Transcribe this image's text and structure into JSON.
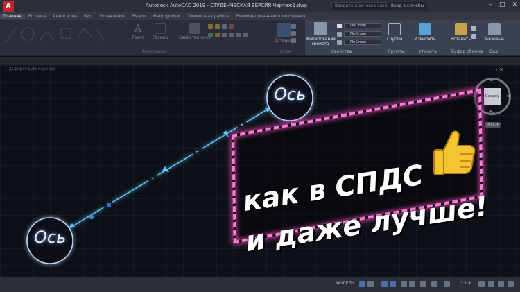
{
  "window": {
    "title": "Autodesk AutoCAD 2019 - СТУДЕНЧЕСКАЯ ВЕРСИЯ    Чертеж1.dwg",
    "app_icon_letter": "A",
    "search_placeholder": "Введите ключевое слово/фразу",
    "signin_label": "Вход в службы",
    "controls": [
      "–",
      "□",
      "✕"
    ]
  },
  "ribbon_tabs": [
    "Главная",
    "Вставка",
    "Аннотации",
    "Вид",
    "Управление",
    "Вывод",
    "Надстройки",
    "Совместная работа",
    "Рекомендованные приложения"
  ],
  "ribbon_panels": {
    "annotation_label": "Аннотации",
    "blocks_label": "Блок",
    "properties_label": "Свойства",
    "groups_label": "Группы",
    "utilities_label": "Утилиты",
    "clipboard_label": "Буфер обмена",
    "view_label": "Вид",
    "layer_props_label": "Свойства слоя",
    "text_tool": "Текст",
    "dim_tool": "Размер",
    "insert_tool": "Вставка",
    "match_props_tool": "Копирование свойств",
    "groups_tool": "Группа",
    "measure_tool": "Измерить",
    "paste_tool": "Вставить",
    "base_tool": "Базовый",
    "bylayer_1": "ПоСлою",
    "bylayer_2": "ПоСлою",
    "bylayer_3": "ПоСлою"
  },
  "view_label": "[-][Сверху][2D-каркас]",
  "axis_markers": {
    "label_top": "Ось",
    "label_bottom": "Ось"
  },
  "viewcube": {
    "face": "Сверху",
    "north": "С",
    "south": "Ю",
    "west": "З",
    "east": "В",
    "wcs": "МСК ▾"
  },
  "promo": {
    "line1": "как в СПДС",
    "line2": "и даже лучше!",
    "border_color": "#ff7ad9"
  },
  "statusbar": {
    "model_label": "МОДЕЛЬ",
    "scale_label": "1:1 ▾"
  },
  "colors": {
    "accent": "#2f6fd0",
    "axis_line": "#5ec8ff",
    "neon_pink": "#ff4fc8"
  }
}
